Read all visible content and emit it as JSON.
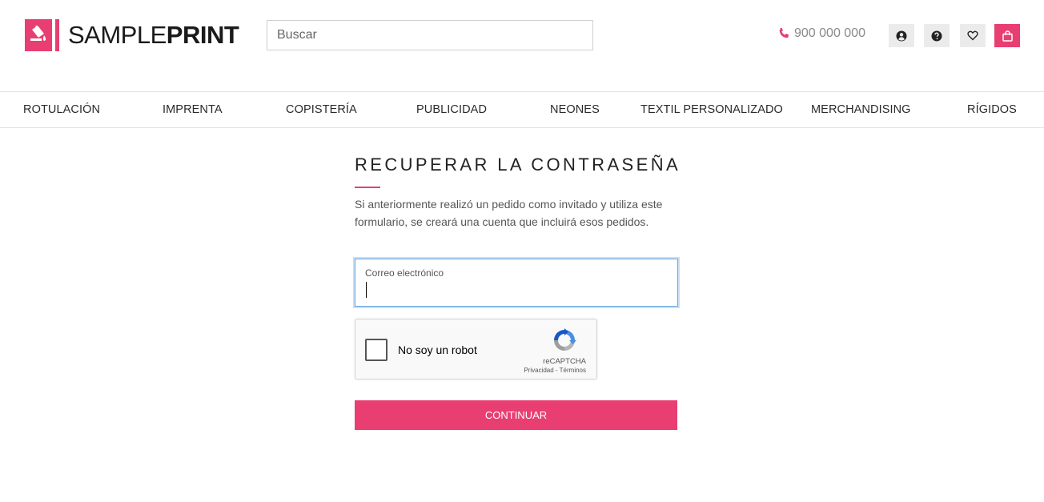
{
  "brand": {
    "name_light": "SAMPLE",
    "name_bold": "PRINT",
    "accent": "#e83e72"
  },
  "search": {
    "placeholder": "Buscar",
    "value": ""
  },
  "contact": {
    "phone": "900 000 000",
    "icon": "phone-icon"
  },
  "header_actions": [
    {
      "name": "account",
      "icon": "user-circle-icon"
    },
    {
      "name": "help",
      "icon": "question-circle-icon"
    },
    {
      "name": "wishlist",
      "icon": "heart-icon"
    },
    {
      "name": "cart",
      "icon": "shopping-bag-icon"
    }
  ],
  "nav": {
    "items": [
      "ROTULACIÓN",
      "IMPRENTA",
      "COPISTERÍA",
      "PUBLICIDAD",
      "NEONES",
      "TEXTIL PERSONALIZADO",
      "MERCHANDISING",
      "RÍGIDOS"
    ]
  },
  "page": {
    "title": "RECUPERAR LA CONTRASEÑA",
    "description": "Si anteriormente realizó un pedido como invitado y utiliza este formulario, se creará una cuenta que incluirá esos pedidos."
  },
  "form": {
    "email_label": "Correo electrónico",
    "email_value": "",
    "submit_label": "CONTINUAR"
  },
  "captcha": {
    "label": "No soy un robot",
    "brand": "reCAPTCHA",
    "links": "Privacidad - Términos",
    "checked": false
  }
}
